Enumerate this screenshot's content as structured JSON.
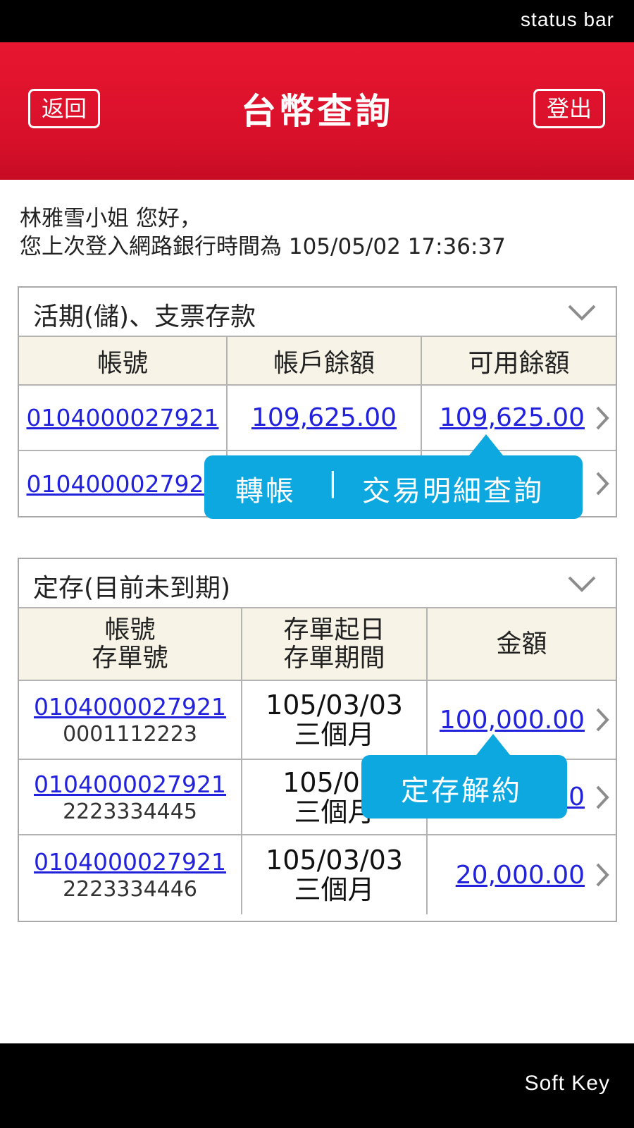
{
  "status_bar": {
    "label": "status bar"
  },
  "header": {
    "back_label": "返回",
    "title": "台幣查詢",
    "logout_label": "登出"
  },
  "greeting": {
    "line1": "林雅雪小姐 您好，",
    "line2": "您上次登入網路銀行時間為 105/05/02 17:36:37"
  },
  "demand": {
    "title": "活期(儲)、支票存款",
    "columns": [
      "帳號",
      "帳戶餘額",
      "可用餘額"
    ],
    "rows": [
      {
        "account": "0104000027921",
        "balance": "109,625.00",
        "available": "109,625.00"
      },
      {
        "account": "0104000027921",
        "balance": "",
        "available": ""
      }
    ],
    "tooltip": {
      "transfer": "轉帳",
      "separator": "|",
      "details": "交易明細查詢"
    }
  },
  "time_deposit": {
    "title": "定存(目前未到期)",
    "columns": [
      {
        "line1": "帳號",
        "line2": "存單號"
      },
      {
        "line1": "存單起日",
        "line2": "存單期間"
      },
      {
        "line1": "金額",
        "line2": ""
      }
    ],
    "rows": [
      {
        "account": "0104000027921",
        "cert": "0001112223",
        "start": "105/03/03",
        "period": "三個月",
        "amount": "100,000.00"
      },
      {
        "account": "0104000027921",
        "cert": "2223334445",
        "start": "105/03/",
        "period": "三個月",
        "amount": "00"
      },
      {
        "account": "0104000027921",
        "cert": "2223334446",
        "start": "105/03/03",
        "period": "三個月",
        "amount": "20,000.00"
      }
    ],
    "tooltip": {
      "terminate": "定存解約"
    }
  },
  "soft_key": {
    "label": "Soft Key"
  },
  "icons": {
    "collapse": "chevron-down-icon",
    "row_arrow": "chevron-right-icon"
  },
  "colors": {
    "header_red": "#e81630",
    "tooltip_blue": "#0ea8e0",
    "link_blue": "#2222dd",
    "table_header_bg": "#f7f3e6"
  }
}
